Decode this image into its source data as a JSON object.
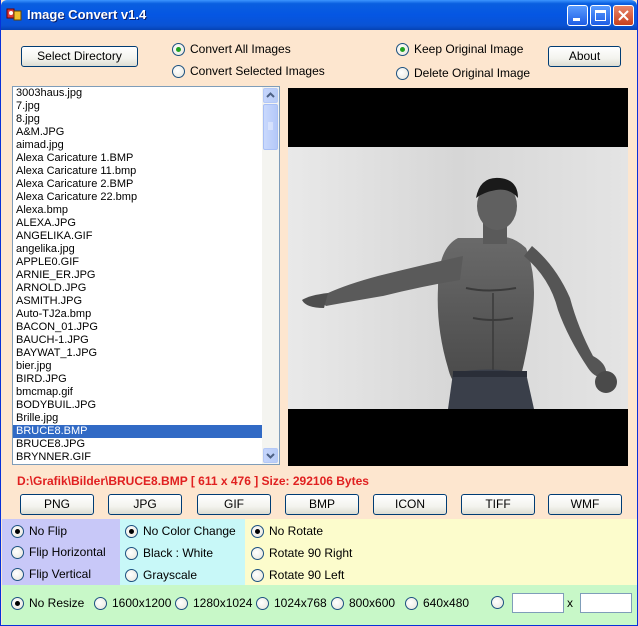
{
  "window": {
    "title": "Image Convert v1.4"
  },
  "titlebar_buttons": {
    "minimize_icon": "minimize-icon",
    "maximize_icon": "maximize-icon",
    "close_icon": "close-icon"
  },
  "top": {
    "select_directory": "Select Directory",
    "about": "About",
    "convert_options": [
      {
        "label": "Convert All Images",
        "selected": true
      },
      {
        "label": "Convert Selected Images",
        "selected": false
      }
    ],
    "original_options": [
      {
        "label": "Keep Original Image",
        "selected": true
      },
      {
        "label": "Delete Original Image",
        "selected": false
      }
    ]
  },
  "files": {
    "items": [
      "3003haus.jpg",
      "7.jpg",
      "8.jpg",
      "A&M.JPG",
      "aimad.jpg",
      "Alexa Caricature 1.BMP",
      "Alexa Caricature 11.bmp",
      "Alexa Caricature 2.BMP",
      "Alexa Caricature 22.bmp",
      "Alexa.bmp",
      "ALEXA.JPG",
      "ANGELIKA.GIF",
      "angelika.jpg",
      "APPLE0.GIF",
      "ARNIE_ER.JPG",
      "ARNOLD.JPG",
      "ASMITH.JPG",
      "Auto-TJ2a.bmp",
      "BACON_01.JPG",
      "BAUCH-1.JPG",
      "BAYWAT_1.JPG",
      "bier.jpg",
      "BIRD.JPG",
      "bmcmap.gif",
      "BODYBUIL.JPG",
      "Brille.jpg",
      "BRUCE8.BMP",
      "BRUCE8.JPG",
      "BRYNNER.GIF"
    ],
    "selected": "BRUCE8.BMP"
  },
  "status": {
    "text": "D:\\Grafik\\Bilder\\BRUCE8.BMP [ 611 x 476 ]    Size: 292106 Bytes"
  },
  "formats": [
    "PNG",
    "JPG",
    "GIF",
    "BMP",
    "ICON",
    "TIFF",
    "WMF"
  ],
  "flip": [
    {
      "label": "No Flip",
      "selected": true
    },
    {
      "label": "Flip Horizontal",
      "selected": false
    },
    {
      "label": "Flip Vertical",
      "selected": false
    }
  ],
  "color": [
    {
      "label": "No Color Change",
      "selected": true
    },
    {
      "label": "Black : White",
      "selected": false
    },
    {
      "label": "Grayscale",
      "selected": false
    }
  ],
  "rotate": [
    {
      "label": "No Rotate",
      "selected": true
    },
    {
      "label": "Rotate 90 Right",
      "selected": false
    },
    {
      "label": "Rotate 90 Left",
      "selected": false
    }
  ],
  "resize": {
    "options": [
      {
        "label": "No Resize",
        "selected": true
      },
      {
        "label": "1600x1200",
        "selected": false
      },
      {
        "label": "1280x1024",
        "selected": false
      },
      {
        "label": "1024x768",
        "selected": false
      },
      {
        "label": "800x600",
        "selected": false
      },
      {
        "label": "640x480",
        "selected": false
      },
      {
        "label": "",
        "selected": false
      }
    ],
    "custom_width": "",
    "custom_height": "",
    "separator": "x"
  },
  "colors": {
    "status_red": "#e02020",
    "selection_blue": "#316ac5"
  }
}
